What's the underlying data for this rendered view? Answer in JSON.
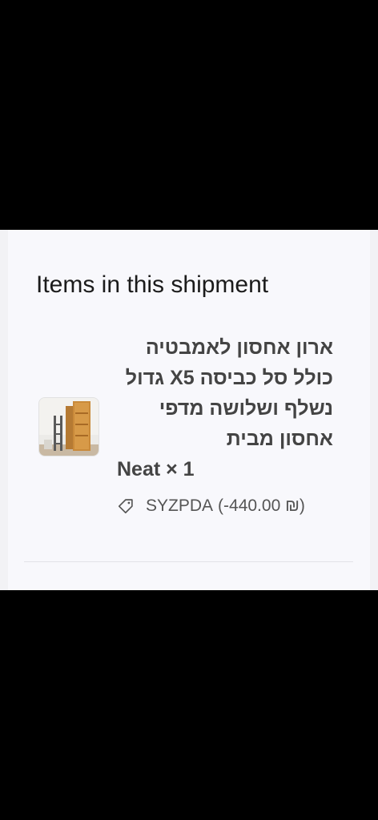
{
  "shipment": {
    "section_title": "Items in this shipment",
    "item": {
      "name": "ארון אחסון לאמבטיה כולל סל כביסה X5 גדול נשלף ושלושה מדפי אחסון מבית",
      "name_tail": "Neat × 1",
      "discount_code": "SYZPDA",
      "discount_amount": "(-440.00 ₪)"
    }
  },
  "icons": {
    "thumbnail": "product-thumbnail-image",
    "discount": "tag-icon"
  },
  "colors": {
    "page_background": "#f8f8fc",
    "text_primary": "#1b1b1b",
    "text_secondary": "#444444",
    "divider": "#e3e3e8"
  }
}
